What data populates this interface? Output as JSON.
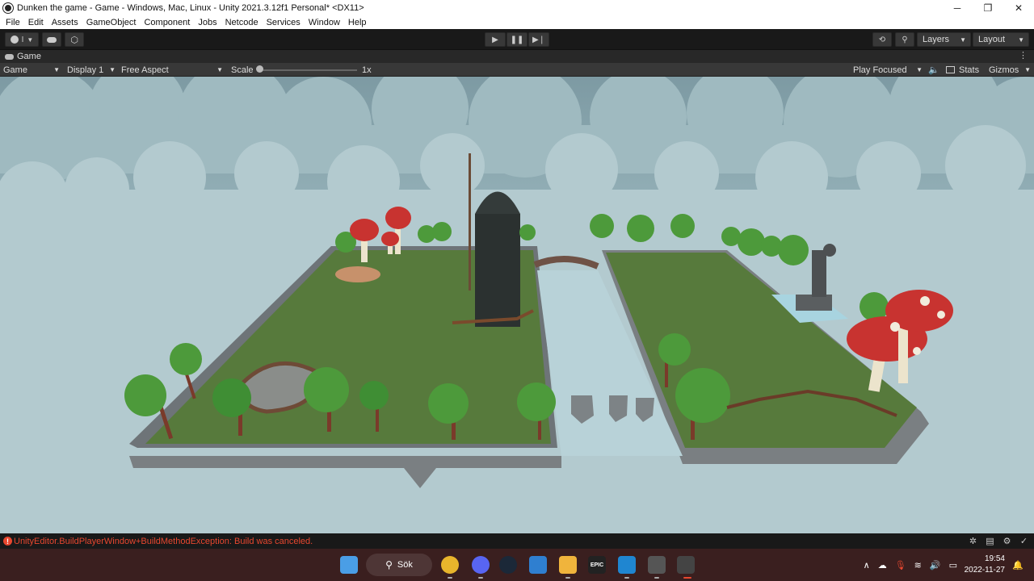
{
  "window": {
    "title": "Dunken the game - Game - Windows, Mac, Linux - Unity 2021.3.12f1 Personal* <DX11>",
    "controls": [
      "─",
      "❐",
      "✕"
    ]
  },
  "menu": [
    "File",
    "Edit",
    "Assets",
    "GameObject",
    "Component",
    "Jobs",
    "Netcode",
    "Services",
    "Window",
    "Help"
  ],
  "toolbar": {
    "account_label": "I",
    "layers_label": "Layers",
    "layout_label": "Layout"
  },
  "tab": {
    "label": "Game"
  },
  "gamebar": {
    "display_mode": "Game",
    "display": "Display 1",
    "aspect": "Free Aspect",
    "scale_label": "Scale",
    "scale_value": "1x",
    "play_mode": "Play Focused",
    "stats_label": "Stats",
    "gizmos_label": "Gizmos"
  },
  "status": {
    "error_message": "UnityEditor.BuildPlayerWindow+BuildMethodException: Build was canceled."
  },
  "taskbar": {
    "search_label": "Sök",
    "epic_label": "EPIC",
    "time": "19:54",
    "date": "2022-11-27"
  },
  "colors": {
    "sky": "#a8c3c9",
    "grass": "#577a3c",
    "error": "#e8472f",
    "taskbar": "#3a1f1f"
  }
}
